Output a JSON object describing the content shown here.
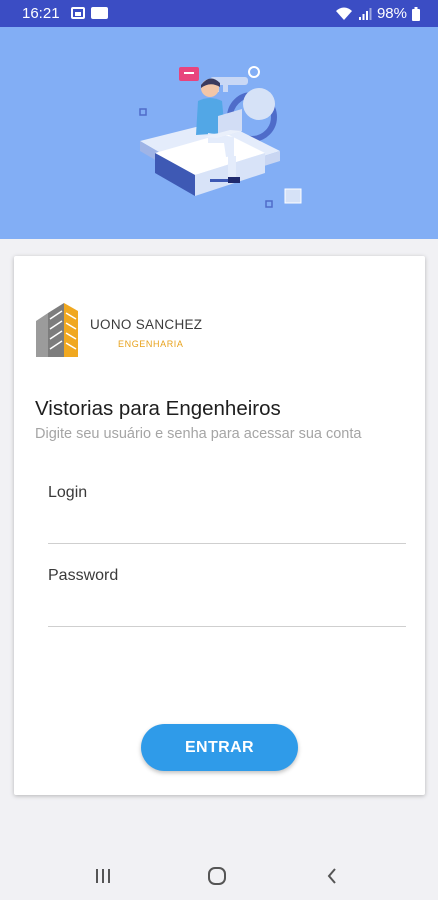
{
  "status_bar": {
    "time": "16:21",
    "battery": "98%",
    "icons": [
      "image-icon",
      "ms-icon",
      "wifi-icon",
      "signal-icon",
      "battery-icon"
    ]
  },
  "hero": {
    "illustration": "person-with-laptop-and-key-illustration",
    "background_color": "#82aef5"
  },
  "logo": {
    "name": "UONO SANCHEZ",
    "subtitle": "ENGENHARIA"
  },
  "login_form": {
    "title": "Vistorias para Engenheiros",
    "subtitle": "Digite seu usuário e senha para acessar sua conta",
    "login_label": "Login",
    "login_value": "",
    "password_label": "Password",
    "password_value": "",
    "submit_label": "ENTRAR"
  },
  "colors": {
    "status_bar": "#3b4dc4",
    "accent_button": "#2f9be9",
    "logo_gold": "#e8a21c"
  },
  "nav_bar": {
    "buttons": [
      "recent-apps-icon",
      "home-icon",
      "back-icon"
    ]
  }
}
